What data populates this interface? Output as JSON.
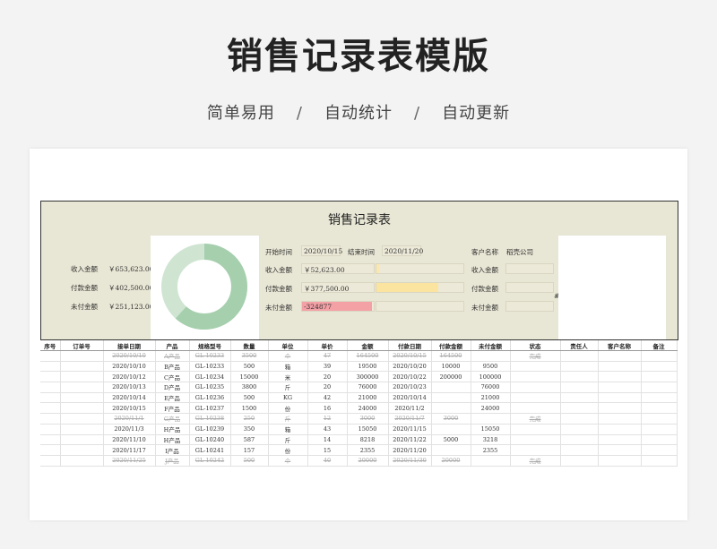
{
  "page": {
    "title": "销售记录表模版",
    "subtitle": [
      "简单易用",
      "自动统计",
      "自动更新"
    ],
    "subtitle_sep": "/"
  },
  "dashboard": {
    "title": "销售记录表",
    "left": [
      {
        "label": "收入金额",
        "value": "￥653,623.00"
      },
      {
        "label": "付款金额",
        "value": "￥402,500.00"
      },
      {
        "label": "未付金额",
        "value": "￥251,123.00"
      }
    ],
    "donut": {
      "paid_fraction": 0.616,
      "paid_color": "#a6cfae",
      "unpaid_color": "#cfe5d2"
    },
    "start_label": "开始时间",
    "start_value": "2020/10/15",
    "end_label": "结束时间",
    "end_value": "2020/11/20",
    "mid": [
      {
        "label": "收入金额",
        "value": "￥52,623.00",
        "fill": 0.03,
        "color": "#fbe8b0"
      },
      {
        "label": "付款金额",
        "value": "￥377,500.00",
        "fill": 0.73,
        "color": "#fbe3a0"
      },
      {
        "label": "未付金额",
        "value": "-324877",
        "fill": 1.0,
        "color": "#f4a1a6"
      }
    ],
    "customer_label": "客户名称",
    "customer_value": "稻壳公司",
    "right": [
      "收入金额",
      "付款金额",
      "未付金额"
    ],
    "hash": "#"
  },
  "table": {
    "headers": [
      "序号",
      "订单号",
      "接单日期",
      "产品",
      "规格型号",
      "数量",
      "单位",
      "单价",
      "金额",
      "付款日期",
      "付款金额",
      "未付金额",
      "状态",
      "责任人",
      "客户名称",
      "备注"
    ],
    "rows": [
      {
        "done": true,
        "cells": [
          "",
          "",
          "2020/10/10",
          "A产品",
          "GL-10233",
          "3500",
          "个",
          "47",
          "164500",
          "2020/10/15",
          "164500",
          "",
          "完成",
          "",
          "",
          ""
        ]
      },
      {
        "done": false,
        "cells": [
          "",
          "",
          "2020/10/10",
          "B产品",
          "GL-10233",
          "500",
          "箱",
          "39",
          "19500",
          "2020/10/20",
          "10000",
          "9500",
          "",
          "",
          "",
          ""
        ]
      },
      {
        "done": false,
        "cells": [
          "",
          "",
          "2020/10/12",
          "C产品",
          "GL-10234",
          "15000",
          "米",
          "20",
          "300000",
          "2020/10/22",
          "200000",
          "100000",
          "",
          "",
          "",
          ""
        ]
      },
      {
        "done": false,
        "cells": [
          "",
          "",
          "2020/10/13",
          "D产品",
          "GL-10235",
          "3800",
          "斤",
          "20",
          "76000",
          "2020/10/23",
          "",
          "76000",
          "",
          "",
          "",
          ""
        ]
      },
      {
        "done": false,
        "cells": [
          "",
          "",
          "2020/10/14",
          "E产品",
          "GL-10236",
          "500",
          "KG",
          "42",
          "21000",
          "2020/10/14",
          "",
          "21000",
          "",
          "",
          "",
          ""
        ]
      },
      {
        "done": false,
        "cells": [
          "",
          "",
          "2020/10/15",
          "F产品",
          "GL-10237",
          "1500",
          "份",
          "16",
          "24000",
          "2020/11/2",
          "",
          "24000",
          "",
          "",
          "",
          ""
        ]
      },
      {
        "done": true,
        "cells": [
          "",
          "",
          "2020/11/1",
          "G产品",
          "GL-10238",
          "250",
          "斤",
          "12",
          "3000",
          "2020/11/7",
          "3000",
          "",
          "完成",
          "",
          "",
          ""
        ]
      },
      {
        "done": false,
        "cells": [
          "",
          "",
          "2020/11/3",
          "H产品",
          "GL-10239",
          "350",
          "箱",
          "43",
          "15050",
          "2020/11/15",
          "",
          "15050",
          "",
          "",
          "",
          ""
        ]
      },
      {
        "done": false,
        "cells": [
          "",
          "",
          "2020/11/10",
          "H产品",
          "GL-10240",
          "587",
          "斤",
          "14",
          "8218",
          "2020/11/22",
          "5000",
          "3218",
          "",
          "",
          "",
          ""
        ]
      },
      {
        "done": false,
        "cells": [
          "",
          "",
          "2020/11/17",
          "I产品",
          "GL-10241",
          "157",
          "份",
          "15",
          "2355",
          "2020/11/20",
          "",
          "2355",
          "",
          "",
          "",
          ""
        ]
      },
      {
        "done": true,
        "cells": [
          "",
          "",
          "2020/11/25",
          "J产品",
          "GL-10242",
          "500",
          "个",
          "40",
          "20000",
          "2020/11/30",
          "20000",
          "",
          "完成",
          "",
          "",
          ""
        ]
      }
    ]
  }
}
